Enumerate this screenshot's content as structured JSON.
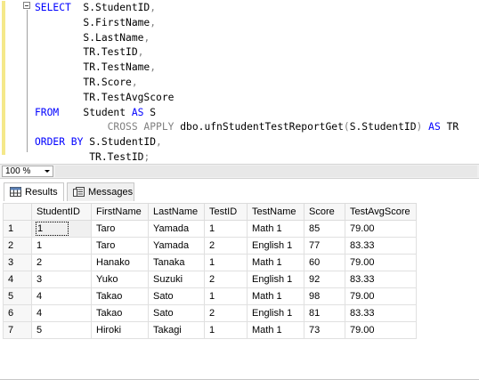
{
  "editor": {
    "lines": [
      [
        {
          "t": "SELECT",
          "c": "kw"
        },
        {
          "t": "  S.StudentID"
        },
        {
          "t": ",",
          "c": "gk"
        }
      ],
      [
        {
          "t": "        S.FirstName"
        },
        {
          "t": ",",
          "c": "gk"
        }
      ],
      [
        {
          "t": "        S.LastName"
        },
        {
          "t": ",",
          "c": "gk"
        }
      ],
      [
        {
          "t": "        TR.TestID"
        },
        {
          "t": ",",
          "c": "gk"
        }
      ],
      [
        {
          "t": "        TR.TestName"
        },
        {
          "t": ",",
          "c": "gk"
        }
      ],
      [
        {
          "t": "        TR.Score"
        },
        {
          "t": ",",
          "c": "gk"
        }
      ],
      [
        {
          "t": "        TR.TestAvgScore"
        }
      ],
      [
        {
          "t": "FROM",
          "c": "kw"
        },
        {
          "t": "    Student "
        },
        {
          "t": "AS",
          "c": "kw"
        },
        {
          "t": " S"
        }
      ],
      [
        {
          "t": "            "
        },
        {
          "t": "CROSS APPLY",
          "c": "gk"
        },
        {
          "t": " dbo.ufnStudentTestReportGet"
        },
        {
          "t": "(",
          "c": "gk"
        },
        {
          "t": "S.StudentID"
        },
        {
          "t": ")",
          "c": "gk"
        },
        {
          "t": " "
        },
        {
          "t": "AS",
          "c": "kw"
        },
        {
          "t": " TR"
        }
      ],
      [
        {
          "t": "ORDER BY",
          "c": "kw"
        },
        {
          "t": " S.StudentID"
        },
        {
          "t": ",",
          "c": "gk"
        }
      ],
      [
        {
          "t": "         TR.TestID"
        },
        {
          "t": ";",
          "c": "gk"
        }
      ]
    ]
  },
  "zoom": {
    "value": "100 %"
  },
  "tabs": {
    "results": "Results",
    "messages": "Messages"
  },
  "grid": {
    "columns": [
      "StudentID",
      "FirstName",
      "LastName",
      "TestID",
      "TestName",
      "Score",
      "TestAvgScore"
    ],
    "rows": [
      [
        "1",
        "1",
        "Taro",
        "Yamada",
        "1",
        "Math 1",
        "85",
        "79.00"
      ],
      [
        "2",
        "1",
        "Taro",
        "Yamada",
        "2",
        "English 1",
        "77",
        "83.33"
      ],
      [
        "3",
        "2",
        "Hanako",
        "Tanaka",
        "1",
        "Math 1",
        "60",
        "79.00"
      ],
      [
        "4",
        "3",
        "Yuko",
        "Suzuki",
        "2",
        "English 1",
        "92",
        "83.33"
      ],
      [
        "5",
        "4",
        "Takao",
        "Sato",
        "1",
        "Math 1",
        "98",
        "79.00"
      ],
      [
        "6",
        "4",
        "Takao",
        "Sato",
        "2",
        "English 1",
        "81",
        "83.33"
      ],
      [
        "7",
        "5",
        "Hiroki",
        "Takagi",
        "1",
        "Math 1",
        "73",
        "79.00"
      ]
    ]
  }
}
